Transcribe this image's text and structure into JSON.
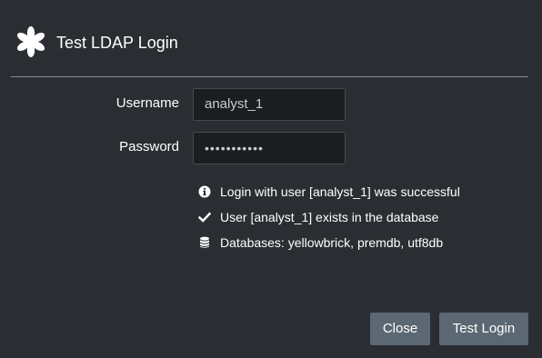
{
  "dialog": {
    "title": "Test LDAP Login"
  },
  "form": {
    "username_label": "Username",
    "username_value": "analyst_1",
    "password_label": "Password",
    "password_value": "•••••••••••"
  },
  "messages": [
    {
      "icon": "info-circle-icon",
      "text": "Login with user [analyst_1] was successful"
    },
    {
      "icon": "checkmark-icon",
      "text": "User [analyst_1] exists in the database"
    },
    {
      "icon": "database-icon",
      "text": "Databases: yellowbrick, premdb, utf8db"
    }
  ],
  "buttons": {
    "close_label": "Close",
    "test_login_label": "Test Login"
  },
  "colors": {
    "background": "#2a2e33",
    "field_background": "#1b1d20",
    "button": "#5b6773",
    "text": "#ffffff"
  }
}
